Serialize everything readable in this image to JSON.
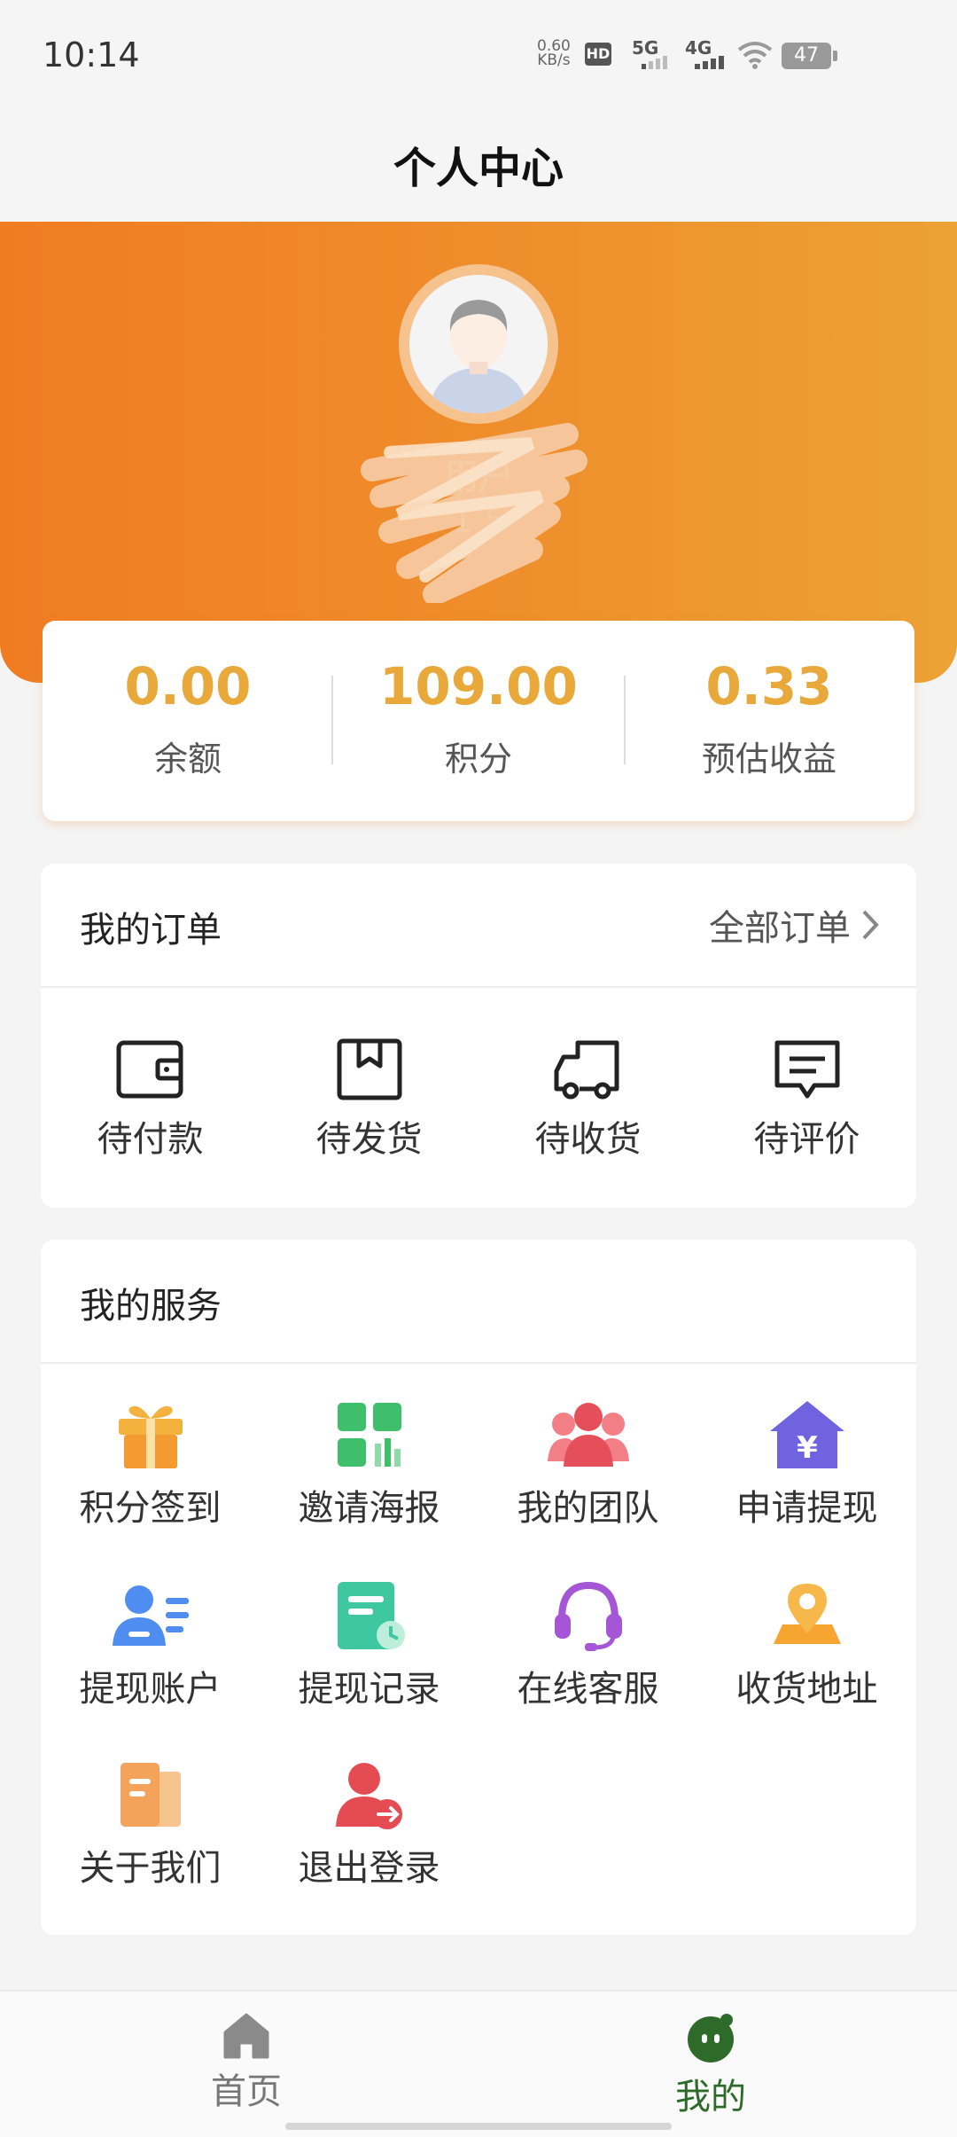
{
  "status_bar": {
    "time": "10:14",
    "net_speed": "0.60",
    "net_unit": "KB/s",
    "hd": "HD",
    "sig1": "5G",
    "sig2": "4G",
    "battery": "47"
  },
  "nav": {
    "title": "个人中心"
  },
  "profile": {
    "name": "用户",
    "phone": "1 5",
    "avatar_icon": "user-avatar"
  },
  "stats": [
    {
      "value": "0.00",
      "label": "余额"
    },
    {
      "value": "109.00",
      "label": "积分"
    },
    {
      "value": "0.33",
      "label": "预估收益"
    }
  ],
  "orders": {
    "title": "我的订单",
    "all_label": "全部订单",
    "items": [
      {
        "label": "待付款",
        "icon": "wallet-icon"
      },
      {
        "label": "待发货",
        "icon": "box-icon"
      },
      {
        "label": "待收货",
        "icon": "truck-icon"
      },
      {
        "label": "待评价",
        "icon": "comment-icon"
      }
    ]
  },
  "services": {
    "title": "我的服务",
    "items": [
      {
        "label": "积分签到",
        "icon": "gift-icon"
      },
      {
        "label": "邀请海报",
        "icon": "poster-icon"
      },
      {
        "label": "我的团队",
        "icon": "team-icon"
      },
      {
        "label": "申请提现",
        "icon": "withdraw-icon"
      },
      {
        "label": "提现账户",
        "icon": "account-icon"
      },
      {
        "label": "提现记录",
        "icon": "record-icon"
      },
      {
        "label": "在线客服",
        "icon": "headset-icon"
      },
      {
        "label": "收货地址",
        "icon": "location-icon"
      },
      {
        "label": "关于我们",
        "icon": "about-icon"
      },
      {
        "label": "退出登录",
        "icon": "logout-icon"
      }
    ]
  },
  "tabbar": {
    "items": [
      {
        "label": "首页",
        "icon": "home-icon",
        "active": false
      },
      {
        "label": "我的",
        "icon": "mine-icon",
        "active": true
      }
    ],
    "active_color": "#2e6b2a",
    "inactive_color": "#777777"
  },
  "colors": {
    "accent": "#ee8a2a",
    "stat_value": "#e8a93a"
  }
}
